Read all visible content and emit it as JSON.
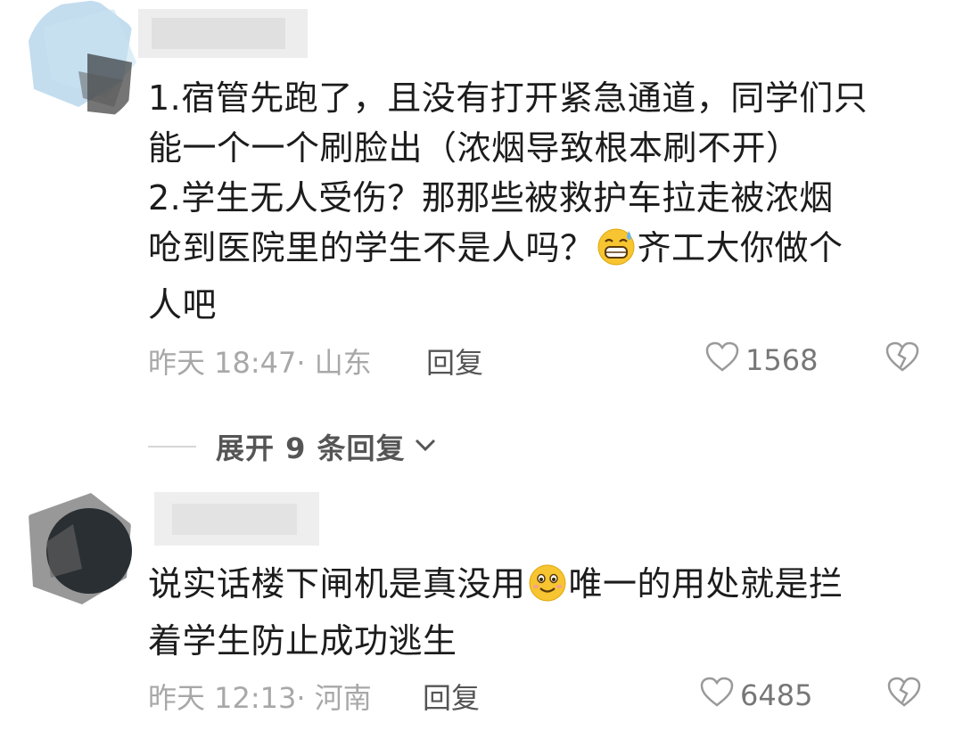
{
  "comments": [
    {
      "content": "1.宿管先跑了，且没有打开紧急通道，同学们只\n能一个一个刷脸出（浓烟导致根本刷不开）\n2.学生无人受伤？那那些被救护车拉走被浓烟\n呛到医院里的学生不是人吗？",
      "content_after_emoji": "齐工大你做个\n人吧",
      "emoji": "sweat-grin-emoji",
      "time_location": "昨天 18:47· 山东",
      "reply_label": "回复",
      "likes": "1568"
    },
    {
      "content": "说实话楼下闸机是真没用",
      "content_after_emoji": "唯一的用处就是拦\n着学生防止成功逃生",
      "emoji": "smile-emoji",
      "time_location": "昨天 12:13· 河南",
      "reply_label": "回复",
      "likes": "6485"
    }
  ],
  "expand_replies": {
    "label": "展开 9 条回复"
  },
  "colors": {
    "text": "#1c1c1c",
    "meta": "#a8a8a8",
    "accent_gray": "#555555"
  },
  "icons": [
    "heart-outline-icon",
    "broken-heart-icon",
    "chevron-down-icon"
  ]
}
